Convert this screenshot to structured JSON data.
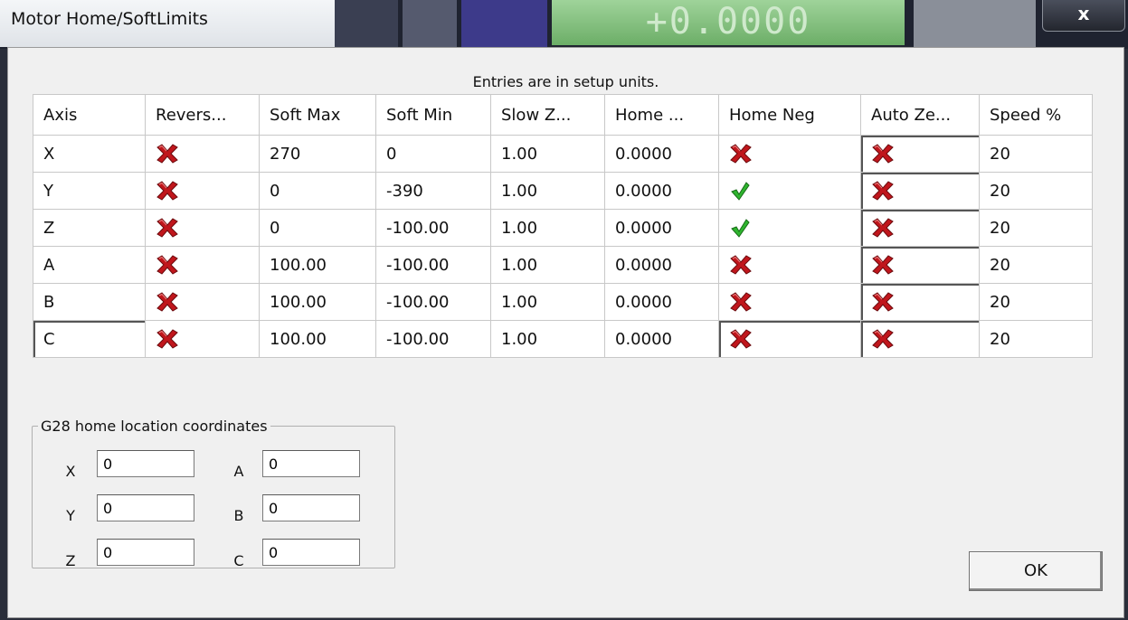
{
  "window": {
    "title": "Motor Home/SoftLimits",
    "close_glyph": "x"
  },
  "background": {
    "readout": "+0.0000"
  },
  "caption": "Entries are in setup units.",
  "table": {
    "columns": [
      "Axis",
      "Revers...",
      "Soft Max",
      "Soft Min",
      "Slow Z...",
      "Home ...",
      "Home Neg",
      "Auto Ze...",
      "Speed %"
    ],
    "rows": [
      {
        "axis": "X",
        "reversed": "no",
        "soft_max": "270",
        "soft_min": "0",
        "slow_zone": "1.00",
        "home_offset": "0.0000",
        "home_neg": "no",
        "auto_zero": "no",
        "speed": "20"
      },
      {
        "axis": "Y",
        "reversed": "no",
        "soft_max": "0",
        "soft_min": "-390",
        "slow_zone": "1.00",
        "home_offset": "0.0000",
        "home_neg": "yes",
        "auto_zero": "no",
        "speed": "20"
      },
      {
        "axis": "Z",
        "reversed": "no",
        "soft_max": "0",
        "soft_min": "-100.00",
        "slow_zone": "1.00",
        "home_offset": "0.0000",
        "home_neg": "yes",
        "auto_zero": "no",
        "speed": "20"
      },
      {
        "axis": "A",
        "reversed": "no",
        "soft_max": "100.00",
        "soft_min": "-100.00",
        "slow_zone": "1.00",
        "home_offset": "0.0000",
        "home_neg": "no",
        "auto_zero": "no",
        "speed": "20"
      },
      {
        "axis": "B",
        "reversed": "no",
        "soft_max": "100.00",
        "soft_min": "-100.00",
        "slow_zone": "1.00",
        "home_offset": "0.0000",
        "home_neg": "no",
        "auto_zero": "no",
        "speed": "20"
      },
      {
        "axis": "C",
        "reversed": "no",
        "soft_max": "100.00",
        "soft_min": "-100.00",
        "slow_zone": "1.00",
        "home_offset": "0.0000",
        "home_neg": "no",
        "auto_zero": "no",
        "speed": "20"
      }
    ]
  },
  "g28": {
    "legend": "G28 home location coordinates",
    "fields": [
      {
        "label": "X",
        "value": "0"
      },
      {
        "label": "A",
        "value": "0"
      },
      {
        "label": "Y",
        "value": "0"
      },
      {
        "label": "B",
        "value": "0"
      },
      {
        "label": "Z",
        "value": "0"
      },
      {
        "label": "C",
        "value": "0"
      }
    ]
  },
  "ok_button": "OK",
  "icons": {
    "no": "red-x-icon",
    "yes": "green-check-icon"
  },
  "colors": {
    "x_icon": "#c0161c",
    "check_icon": "#2fb52f"
  }
}
